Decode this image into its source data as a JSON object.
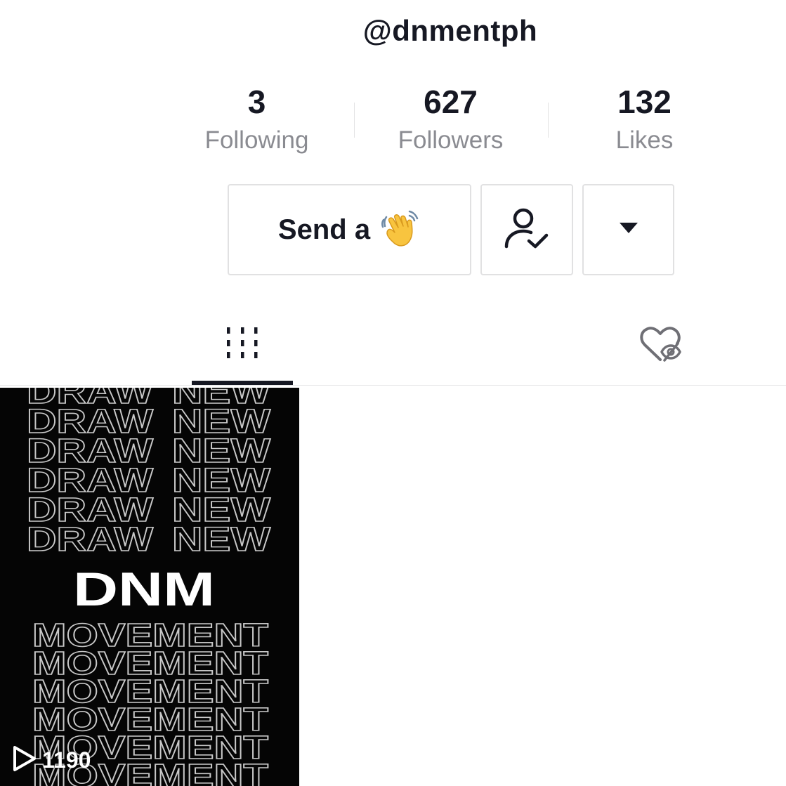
{
  "profile": {
    "username": "@dnmentph"
  },
  "stats": [
    {
      "value": "3",
      "label": "Following"
    },
    {
      "value": "627",
      "label": "Followers"
    },
    {
      "value": "132",
      "label": "Likes"
    }
  ],
  "actions": {
    "wave_label": "Send a",
    "wave_emoji_icon": "waving-hand-icon",
    "follow_icon": "user-check-icon",
    "more_icon": "caret-down-icon"
  },
  "tabs": [
    {
      "name": "videos",
      "icon": "grid-icon",
      "active": true
    },
    {
      "name": "liked",
      "icon": "liked-hidden-icon",
      "active": false
    }
  ],
  "videos": [
    {
      "views": "1190",
      "art": {
        "top_words": [
          "DRAW",
          "NEW"
        ],
        "title": "DNM",
        "bottom_word": "MOVEMENT"
      }
    }
  ],
  "colors": {
    "text_primary": "#161823",
    "text_secondary": "#8a8b91",
    "border": "#e1e1e2",
    "tile_bg": "#050505"
  }
}
